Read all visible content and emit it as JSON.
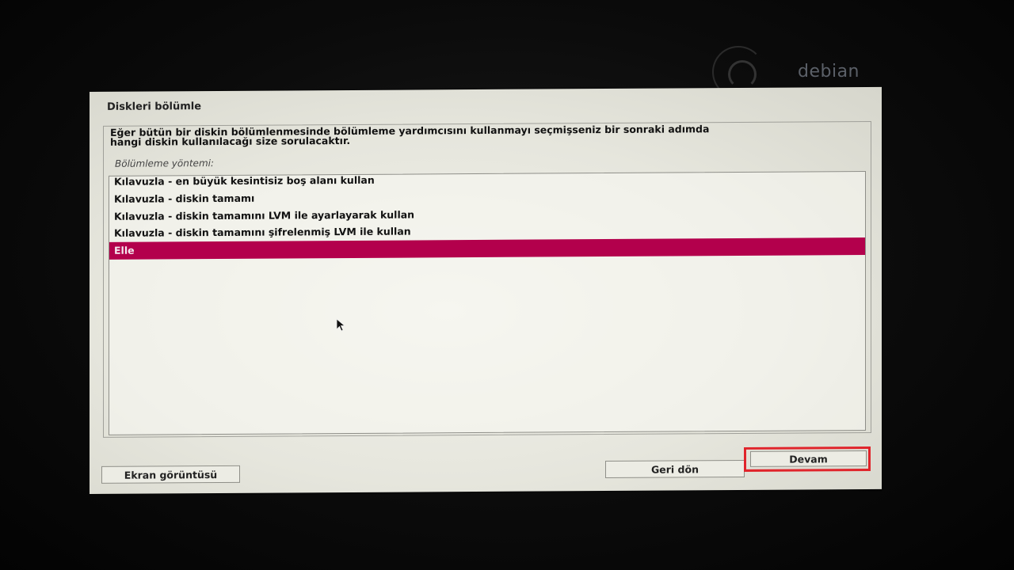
{
  "brand": {
    "logo_text": "debian"
  },
  "dialog": {
    "title": "Diskleri bölümle",
    "description": "Eğer bütün bir diskin bölümlenmesinde bölümleme yardımcısını kullanmayı seçmişseniz bir sonraki adımda\nhangi diskin kullanılacağı size sorulacaktır.",
    "section_label": "Bölümleme yöntemi:",
    "options": [
      "Kılavuzla - en büyük kesintisiz boş alanı kullan",
      "Kılavuzla - diskin tamamı",
      "Kılavuzla - diskin tamamını LVM ile ayarlayarak kullan",
      "Kılavuzla - diskin tamamını şifrelenmiş LVM ile kullan",
      "Elle"
    ],
    "selected_option": "Elle"
  },
  "buttons": {
    "screenshot": "Ekran görüntüsü",
    "back": "Geri dön",
    "continue": "Devam"
  },
  "colors": {
    "selection": "#b3004c",
    "highlight_box": "#e0242b",
    "dialog_bg": "#e8e8df"
  },
  "icons": {
    "logo": "debian-swirl-icon",
    "pointer": "mouse-pointer-icon"
  }
}
